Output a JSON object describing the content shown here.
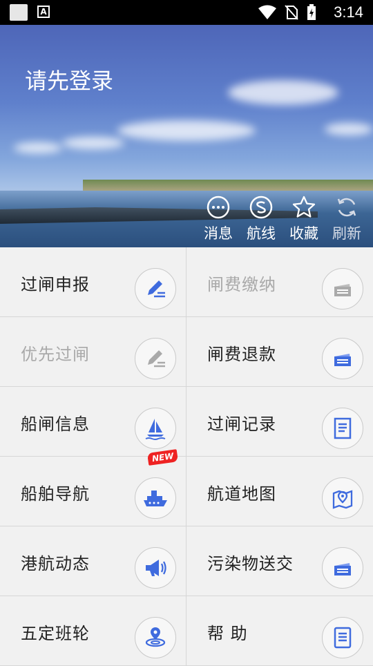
{
  "status_bar": {
    "time": "3:14"
  },
  "header": {
    "login_prompt": "请先登录",
    "actions": [
      {
        "label": "消息",
        "icon": "message-icon"
      },
      {
        "label": "航线",
        "icon": "route-icon"
      },
      {
        "label": "收藏",
        "icon": "star-icon"
      },
      {
        "label": "刷新",
        "icon": "refresh-icon"
      }
    ]
  },
  "menu": [
    {
      "label": "过闸申报",
      "icon": "edit-pen-icon"
    },
    {
      "label": "闸费缴纳",
      "icon": "card-icon"
    },
    {
      "label": "优先过闸",
      "icon": "edit-pen-icon"
    },
    {
      "label": "闸费退款",
      "icon": "card-icon"
    },
    {
      "label": "船闸信息",
      "icon": "sailboat-icon"
    },
    {
      "label": "过闸记录",
      "icon": "receipt-icon"
    },
    {
      "label": "船舶导航",
      "icon": "ship-icon",
      "badge": "NEW"
    },
    {
      "label": "航道地图",
      "icon": "map-pin-icon"
    },
    {
      "label": "港航动态",
      "icon": "megaphone-icon"
    },
    {
      "label": "污染物送交",
      "icon": "card-icon"
    },
    {
      "label": "五定班轮",
      "icon": "location-icon"
    },
    {
      "label": "帮 助",
      "icon": "document-icon"
    }
  ],
  "colors": {
    "accent": "#3f6bde",
    "disabled": "#a9a9a9"
  }
}
